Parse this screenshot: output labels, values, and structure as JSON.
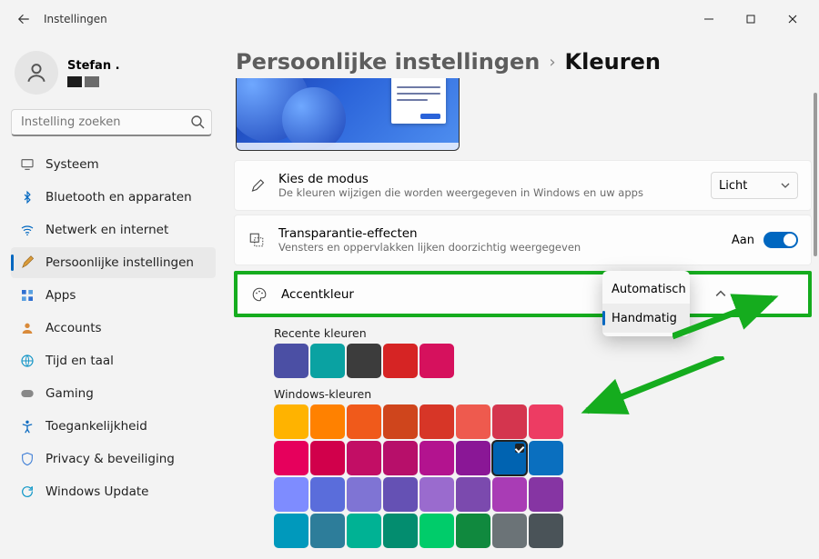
{
  "window": {
    "title": "Instellingen"
  },
  "user": {
    "name": "Stefan .",
    "tiles": [
      "#1d1d1d",
      "#6b6b6b"
    ]
  },
  "search": {
    "placeholder": "Instelling zoeken"
  },
  "nav": [
    {
      "id": "system",
      "icon": "display-icon",
      "label": "Systeem"
    },
    {
      "id": "bt",
      "icon": "bluetooth-icon",
      "label": "Bluetooth en apparaten"
    },
    {
      "id": "network",
      "icon": "wifi-icon",
      "label": "Netwerk en internet"
    },
    {
      "id": "personal",
      "icon": "brush-icon",
      "label": "Persoonlijke instellingen",
      "active": true
    },
    {
      "id": "apps",
      "icon": "grid-icon",
      "label": "Apps"
    },
    {
      "id": "accounts",
      "icon": "person-icon",
      "label": "Accounts"
    },
    {
      "id": "time",
      "icon": "globe-icon",
      "label": "Tijd en taal"
    },
    {
      "id": "gaming",
      "icon": "gamepad-icon",
      "label": "Gaming"
    },
    {
      "id": "access",
      "icon": "accessibility-icon",
      "label": "Toegankelijkheid"
    },
    {
      "id": "privacy",
      "icon": "shield-icon",
      "label": "Privacy & beveiliging"
    },
    {
      "id": "update",
      "icon": "update-icon",
      "label": "Windows Update"
    }
  ],
  "breadcrumb": {
    "parent": "Persoonlijke instellingen",
    "current": "Kleuren"
  },
  "cards": {
    "mode": {
      "title": "Kies de modus",
      "sub": "De kleuren wijzigen die worden weergegeven in Windows en uw apps",
      "value": "Licht"
    },
    "trans": {
      "title": "Transparantie-effecten",
      "sub": "Vensters en oppervlakken lijken doorzichtig weergegeven",
      "value": "Aan"
    },
    "accent": {
      "title": "Accentkleur",
      "options": [
        "Automatisch",
        "Handmatig"
      ],
      "selected": "Handmatig"
    }
  },
  "recent": {
    "label": "Recente kleuren",
    "colors": [
      "#4b4fa4",
      "#0aa2a2",
      "#3c3c3c",
      "#d62424",
      "#d6115d"
    ]
  },
  "windows_colors": {
    "label": "Windows-kleuren",
    "rows": [
      [
        "#ffb300",
        "#ff8100",
        "#f05a1b",
        "#cf451c",
        "#d73627",
        "#ee5a4e",
        "#d4354e",
        "#ed3c63"
      ],
      [
        "#e6005c",
        "#d1004b",
        "#c20e65",
        "#b70f6a",
        "#b3138f",
        "#8a1796",
        "#0063b1",
        "#0a6fbf"
      ],
      [
        "#7e8cff",
        "#5a6ddb",
        "#7f74d4",
        "#6551b4",
        "#9a6bce",
        "#7b4aae",
        "#a93cb5",
        "#8635a3"
      ],
      [
        "#0099bc",
        "#2d7d9a",
        "#00b294",
        "#038d6f",
        "#00cc6a",
        "#10893e",
        "#6b7377",
        "#4a5358"
      ]
    ],
    "selected": [
      1,
      6
    ]
  }
}
